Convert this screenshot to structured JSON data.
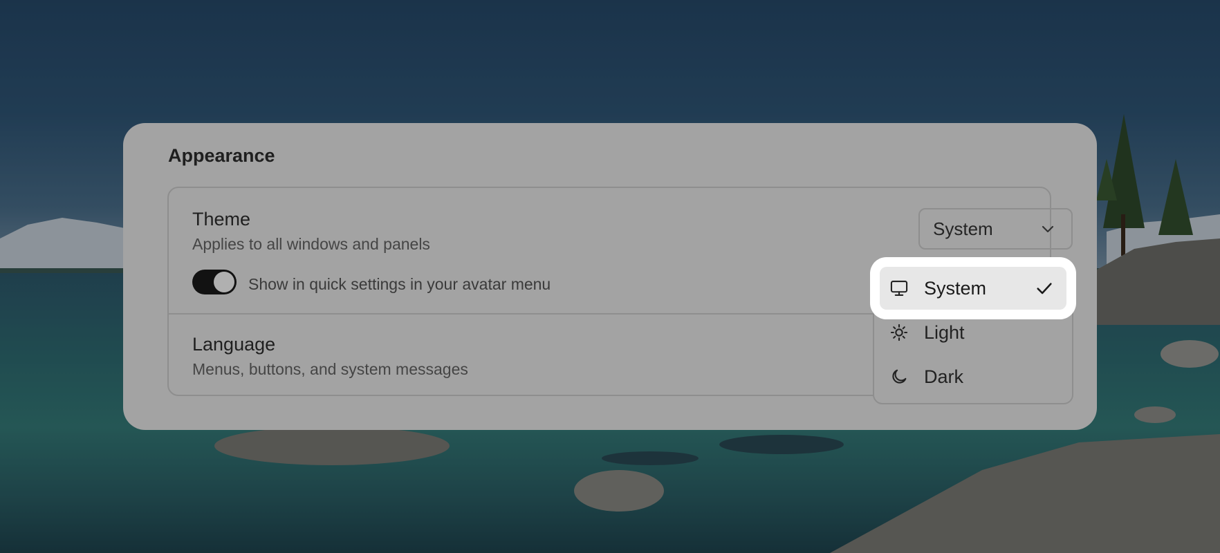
{
  "appearance": {
    "title": "Appearance",
    "theme": {
      "title": "Theme",
      "description": "Applies to all windows and panels",
      "selected": "System",
      "quick_settings_toggle": {
        "label": "Show in quick settings in your avatar menu",
        "on": true
      }
    },
    "language": {
      "title": "Language",
      "description": "Menus, buttons, and system messages"
    }
  },
  "theme_menu": {
    "items": [
      {
        "label": "System",
        "icon": "monitor-icon",
        "selected": true
      },
      {
        "label": "Light",
        "icon": "sun-icon",
        "selected": false
      },
      {
        "label": "Dark",
        "icon": "moon-icon",
        "selected": false
      }
    ]
  }
}
